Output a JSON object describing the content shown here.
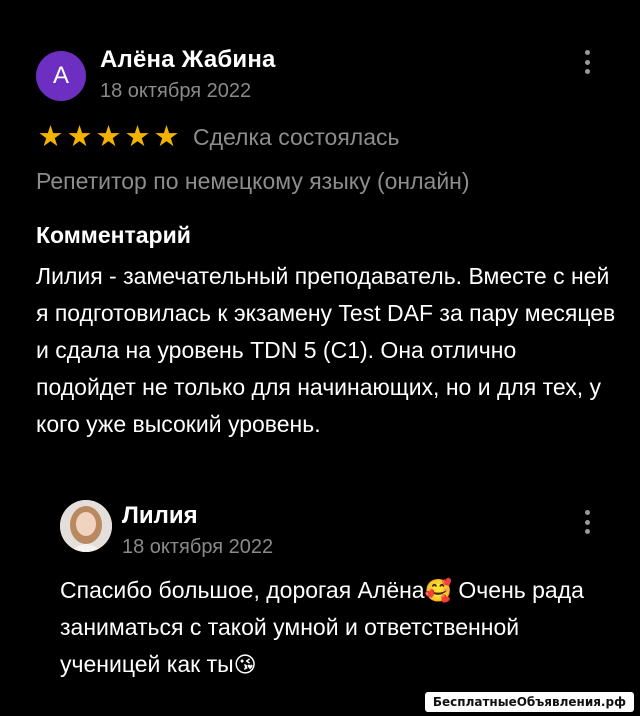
{
  "review": {
    "avatar_letter": "А",
    "author": "Алёна Жабина",
    "date": "18 октября 2022",
    "stars": [
      "★",
      "★",
      "★",
      "★",
      "★"
    ],
    "rating": 5,
    "status": "Сделка состоялась",
    "service": "Репетитор по немецкому языку (онлайн)",
    "comment_title": "Комментарий",
    "comment_text": "Лилия - замечательный преподаватель. Вместе с ней я подготовилась к экзамену Test DAF за пару месяцев и сдала на уровень TDN 5 (C1). Она отлично подойдет не только для начинающих, но и для тех, у кого уже высокий уровень."
  },
  "reply": {
    "author": "Лилия",
    "date": "18 октября 2022",
    "text_part1": "Спасибо большое, дорогая Алёна",
    "emoji1": "🥰",
    "text_part2": " Очень рада заниматься с такой умной и ответственной ученицей как ты",
    "emoji2": "😘"
  },
  "watermark": "БесплатныеОбъявления.рф",
  "colors": {
    "background": "#000000",
    "accent_star": "#f4b300",
    "avatar": "#6d2ec2",
    "muted_text": "#8d8d8d"
  }
}
